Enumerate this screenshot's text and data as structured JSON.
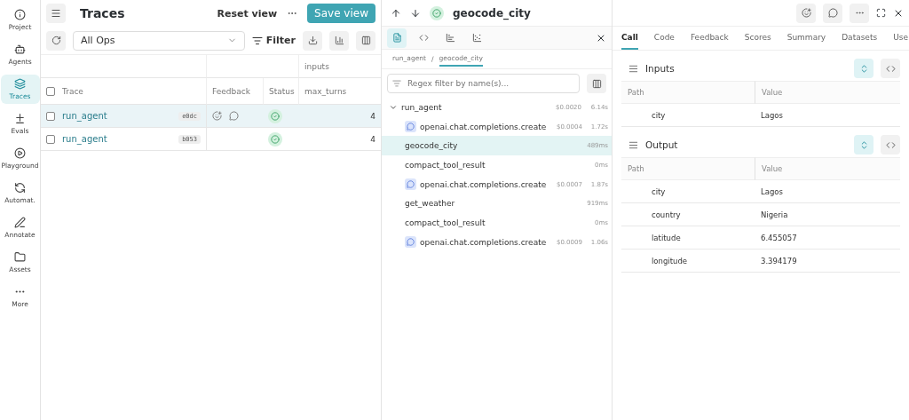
{
  "sidebar": {
    "items": [
      {
        "label": "Project",
        "selected": false
      },
      {
        "label": "Agents",
        "selected": false
      },
      {
        "label": "Traces",
        "selected": true
      },
      {
        "label": "Evals",
        "selected": false
      },
      {
        "label": "Playground",
        "selected": false
      },
      {
        "label": "Automat.",
        "selected": false
      },
      {
        "label": "Annotate",
        "selected": false
      },
      {
        "label": "Assets",
        "selected": false
      },
      {
        "label": "More",
        "selected": false
      }
    ]
  },
  "traces": {
    "title": "Traces",
    "reset": "Reset view",
    "save": "Save view",
    "ops_select": "All Ops",
    "filter": "Filter",
    "group_header": "inputs",
    "select_all_checked": false,
    "columns": [
      "Trace",
      "Feedback",
      "Status",
      "max_turns"
    ],
    "rows": [
      {
        "name": "run_agent",
        "id": "e0dc",
        "has_feedback": true,
        "selected": true,
        "checked": false,
        "max_turns": "4"
      },
      {
        "name": "run_agent",
        "id": "b053",
        "has_feedback": false,
        "selected": false,
        "checked": false,
        "max_turns": "4"
      }
    ]
  },
  "call": {
    "title": "geocode_city",
    "view_tabs": [
      {
        "selected": true
      },
      {
        "selected": false
      },
      {
        "selected": false
      },
      {
        "selected": false
      }
    ],
    "breadcrumbs": [
      {
        "label": "run_agent",
        "selected": false
      },
      {
        "label": "geocode_city",
        "selected": true
      }
    ],
    "breadcrumb_separator": "/",
    "filter_placeholder": "Regex filter by name(s)...",
    "tree": [
      {
        "name": "run_agent",
        "kind": "op",
        "cost": "$0.0020",
        "duration": "6.14s",
        "expanded": true,
        "selected": false,
        "children": [
          {
            "name": "openai.chat.completions.create",
            "kind": "llm",
            "cost": "$0.0004",
            "duration": "1.72s",
            "selected": false
          },
          {
            "name": "geocode_city",
            "kind": "op",
            "duration": "489ms",
            "selected": true
          },
          {
            "name": "compact_tool_result",
            "kind": "op",
            "duration": "0ms",
            "selected": false
          },
          {
            "name": "openai.chat.completions.create",
            "kind": "llm",
            "cost": "$0.0007",
            "duration": "1.87s",
            "selected": false
          },
          {
            "name": "get_weather",
            "kind": "op",
            "duration": "919ms",
            "selected": false
          },
          {
            "name": "compact_tool_result",
            "kind": "op",
            "duration": "0ms",
            "selected": false
          },
          {
            "name": "openai.chat.completions.create",
            "kind": "llm",
            "cost": "$0.0009",
            "duration": "1.06s",
            "selected": false
          }
        ]
      }
    ]
  },
  "details": {
    "tabs": [
      {
        "label": "Call",
        "selected": true
      },
      {
        "label": "Code",
        "selected": false
      },
      {
        "label": "Feedback",
        "selected": false
      },
      {
        "label": "Scores",
        "selected": false
      },
      {
        "label": "Summary",
        "selected": false
      },
      {
        "label": "Datasets",
        "selected": false
      },
      {
        "label": "Use",
        "selected": false
      }
    ],
    "sections": [
      {
        "title": "Inputs",
        "path_header": "Path",
        "value_header": "Value",
        "rows": [
          {
            "path": "city",
            "value": "Lagos"
          }
        ]
      },
      {
        "title": "Output",
        "path_header": "Path",
        "value_header": "Value",
        "rows": [
          {
            "path": "city",
            "value": "Lagos"
          },
          {
            "path": "country",
            "value": "Nigeria"
          },
          {
            "path": "latitude",
            "value": "6.455057"
          },
          {
            "path": "longitude",
            "value": "3.394179"
          }
        ]
      }
    ]
  }
}
